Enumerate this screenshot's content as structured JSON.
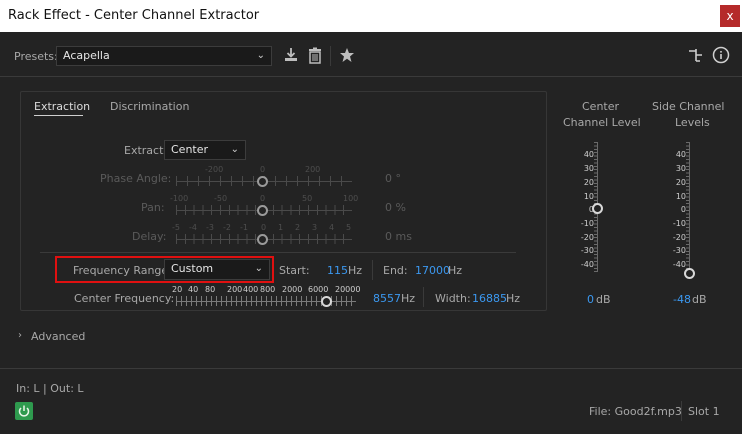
{
  "window": {
    "title": "Rack Effect - Center Channel Extractor",
    "close_glyph": "x"
  },
  "presets": {
    "label": "Presets:",
    "value": "Acapella",
    "icons": [
      "download-icon",
      "trash-icon",
      "star-icon"
    ]
  },
  "top_right_icons": [
    "routing-icon",
    "info-icon"
  ],
  "tabs": [
    {
      "label": "Extraction",
      "active": true
    },
    {
      "label": "Discrimination",
      "active": false
    }
  ],
  "extract": {
    "label": "Extract:",
    "value": "Center"
  },
  "phase_angle": {
    "label": "Phase Angle:",
    "ticks": [
      "-200",
      "0",
      "200"
    ],
    "value": "0",
    "unit": "°"
  },
  "pan": {
    "label": "Pan:",
    "ticks": [
      "-100",
      "-50",
      "0",
      "50",
      "100"
    ],
    "value": "0",
    "unit": "%"
  },
  "delay": {
    "label": "Delay:",
    "ticks": [
      "-5",
      "-4",
      "-3",
      "-2",
      "-1",
      "0",
      "1",
      "2",
      "3",
      "4",
      "5"
    ],
    "value": "0",
    "unit": "ms"
  },
  "frequency_range": {
    "label": "Frequency Range:",
    "value": "Custom",
    "start_label": "Start:",
    "start_value": "115",
    "start_unit": "Hz",
    "end_label": "End:",
    "end_value": "17000",
    "end_unit": "Hz"
  },
  "center_frequency": {
    "label": "Center Frequency:",
    "ticks": [
      "20",
      "40",
      "80",
      "200",
      "400",
      "800",
      "2000",
      "6000",
      "20000"
    ],
    "value": "8557",
    "unit": "Hz",
    "width_label": "Width:",
    "width_value": "16885",
    "width_unit": "Hz"
  },
  "meters": {
    "center": {
      "title_line1": "Center",
      "title_line2": "Channel Level",
      "value": "0",
      "unit": "dB"
    },
    "side": {
      "title_line1": "Side Channel",
      "title_line2": "Levels",
      "value": "-48",
      "unit": "dB"
    },
    "scale": [
      "40",
      "30",
      "20",
      "10",
      "0",
      "-10",
      "-20",
      "-30",
      "-40"
    ]
  },
  "advanced": {
    "label": "Advanced"
  },
  "footer": {
    "io": "In: L | Out: L",
    "file": "File: Good2f.mp3",
    "slot": "Slot 1"
  },
  "colors": {
    "accent_blue": "#3b98f0",
    "highlight_red": "#e01010",
    "power_green": "#2e9a4e"
  }
}
